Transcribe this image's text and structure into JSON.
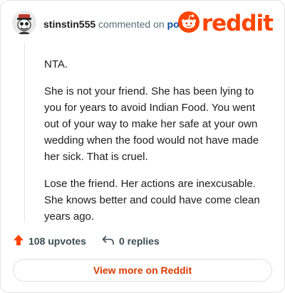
{
  "comment": {
    "username": "stinstin555",
    "action_text": "commented on",
    "post_link": "post",
    "paragraphs": [
      "NTA.",
      "She is not your friend. She has been lying to you for years to avoid Indian Food. You went out of your way to make her safe at your own wedding when the food would not have made her sick. That is cruel.",
      "Lose the friend. Her actions are inexcusable. She knows better and could have come clean years ago."
    ],
    "upvotes_label": "108 upvotes",
    "replies_label": "0 replies"
  },
  "brand": {
    "logo_text": "reddit",
    "icon": "reddit-snoo-icon",
    "accent_color": "#ff4500"
  },
  "footer": {
    "view_more_label": "View more on Reddit"
  }
}
